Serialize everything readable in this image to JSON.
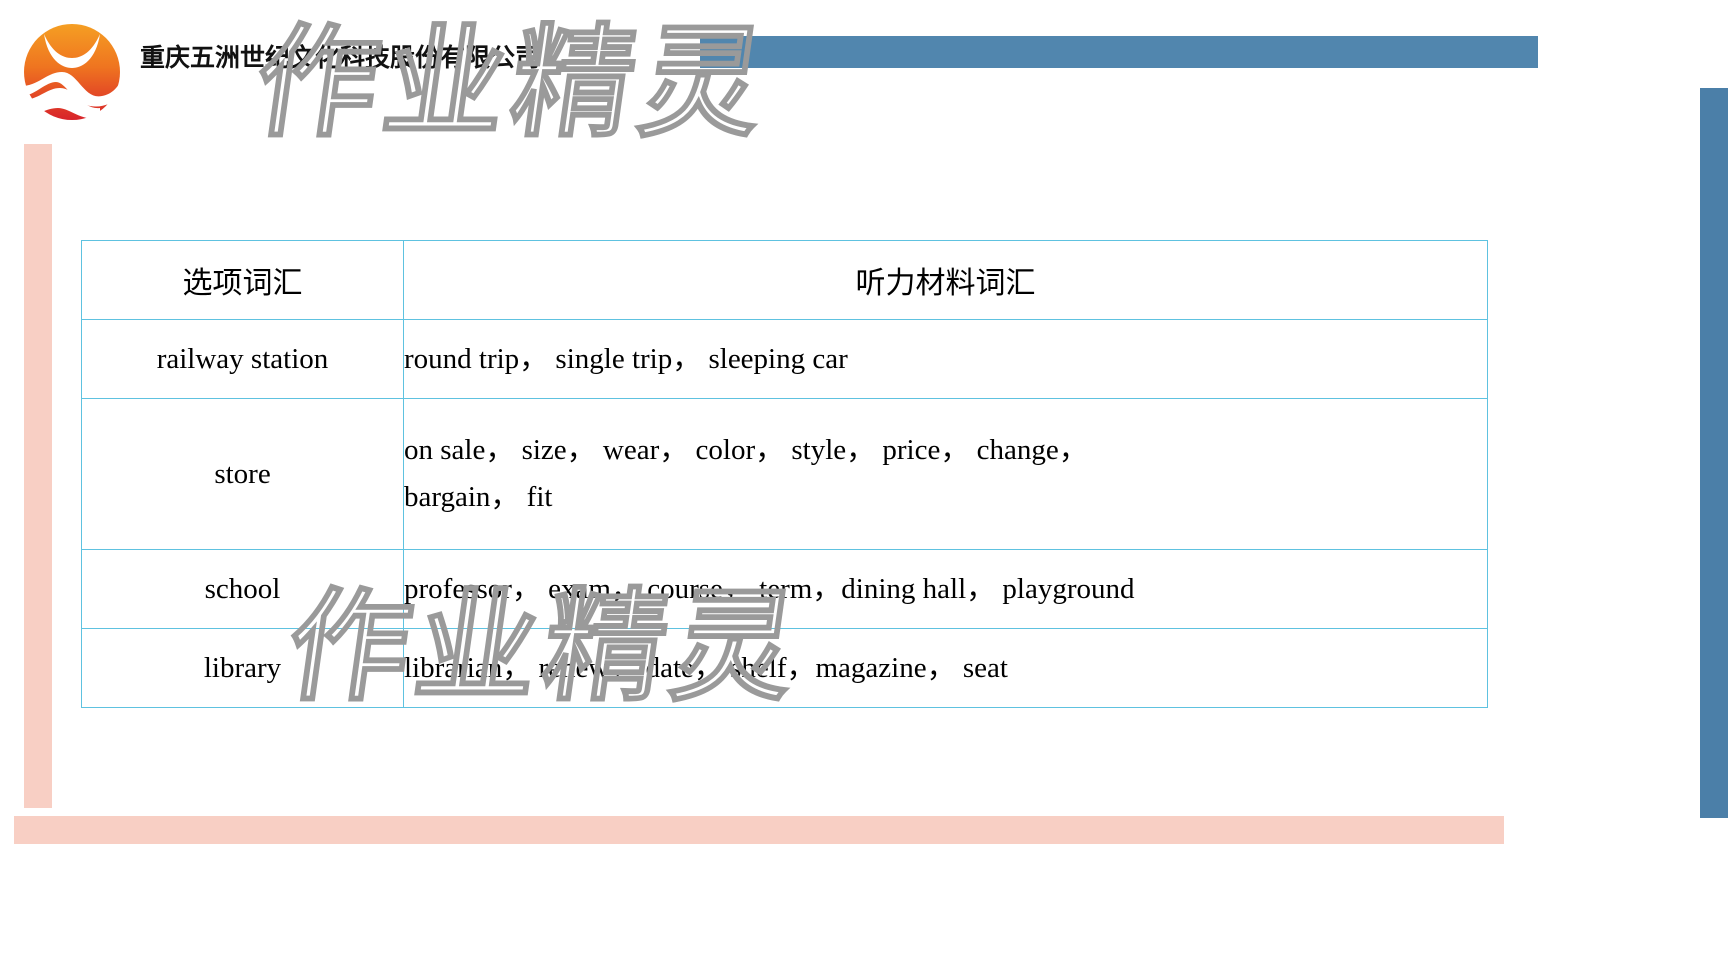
{
  "company": {
    "name": "重庆五洲世纪文化科技股份有限公司",
    "logo_name": "sun-wave-logo"
  },
  "watermark": {
    "text": "作业精灵"
  },
  "table": {
    "headers": {
      "option": "选项词汇",
      "material": "听力材料词汇"
    },
    "rows": [
      {
        "option": "railway station",
        "material_lines": [
          "round trip，  single trip，  sleeping car"
        ]
      },
      {
        "option": "store",
        "material_lines": [
          "on sale，  size，  wear，  color，  style，  price，  change，",
          "bargain，  fit"
        ]
      },
      {
        "option": "school",
        "material_lines": [
          "professor，  exam，  course，  term，dining hall，  playground"
        ]
      },
      {
        "option": "library",
        "material_lines": [
          "librarian，  renew，  date，  shelf，magazine，  seat"
        ]
      }
    ]
  },
  "colors": {
    "header_bar": "#5186ae",
    "right_bar": "#4b7fa8",
    "accent_pink": "#f8cfc4",
    "table_border": "#5ec2e0"
  }
}
